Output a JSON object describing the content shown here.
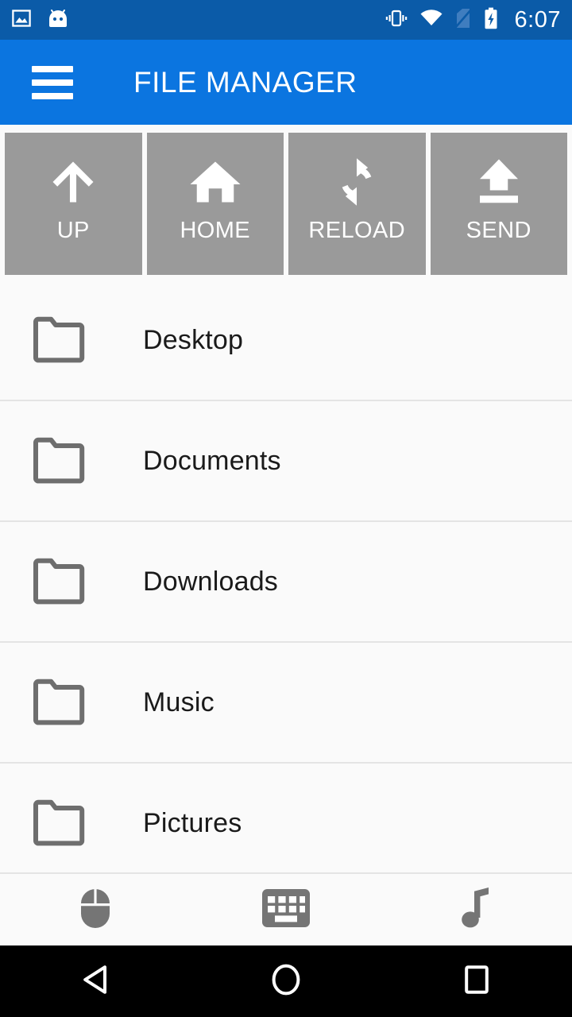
{
  "status_bar": {
    "background": "#0B5BA8",
    "clock": "6:07",
    "left_icons": [
      {
        "name": "image-icon",
        "label": "Screenshot"
      },
      {
        "name": "android-head-icon",
        "label": "Android"
      }
    ],
    "right_icons": [
      {
        "name": "vibrate-icon",
        "label": "Vibrate"
      },
      {
        "name": "wifi-icon",
        "label": "Wi-Fi"
      },
      {
        "name": "no-sim-icon",
        "label": "No SIM"
      },
      {
        "name": "battery-charging-icon",
        "label": "Charging"
      }
    ]
  },
  "app_bar": {
    "background": "#0B75E0",
    "title": "FILE MANAGER",
    "menu_icon": "hamburger-menu-icon"
  },
  "toolbar": {
    "background": "#9a9a9a",
    "buttons": [
      {
        "label": "UP",
        "icon": "arrow-up-icon"
      },
      {
        "label": "HOME",
        "icon": "home-icon"
      },
      {
        "label": "RELOAD",
        "icon": "refresh-icon"
      },
      {
        "label": "SEND",
        "icon": "upload-icon"
      }
    ]
  },
  "file_list": {
    "icon_color": "#6e6e6e",
    "items": [
      {
        "name": "Desktop",
        "icon": "folder-icon"
      },
      {
        "name": "Documents",
        "icon": "folder-icon"
      },
      {
        "name": "Downloads",
        "icon": "folder-icon"
      },
      {
        "name": "Music",
        "icon": "folder-icon"
      },
      {
        "name": "Pictures",
        "icon": "folder-icon"
      }
    ]
  },
  "bottom_bar": {
    "icon_color": "#757575",
    "items": [
      {
        "name": "mouse-icon",
        "label": "Mouse"
      },
      {
        "name": "keyboard-icon",
        "label": "Keyboard"
      },
      {
        "name": "music-note-icon",
        "label": "Music"
      }
    ]
  },
  "nav_bar": {
    "background": "#000000",
    "items": [
      {
        "name": "back-button",
        "label": "Back"
      },
      {
        "name": "home-button",
        "label": "Home"
      },
      {
        "name": "recents-button",
        "label": "Recents"
      }
    ]
  }
}
